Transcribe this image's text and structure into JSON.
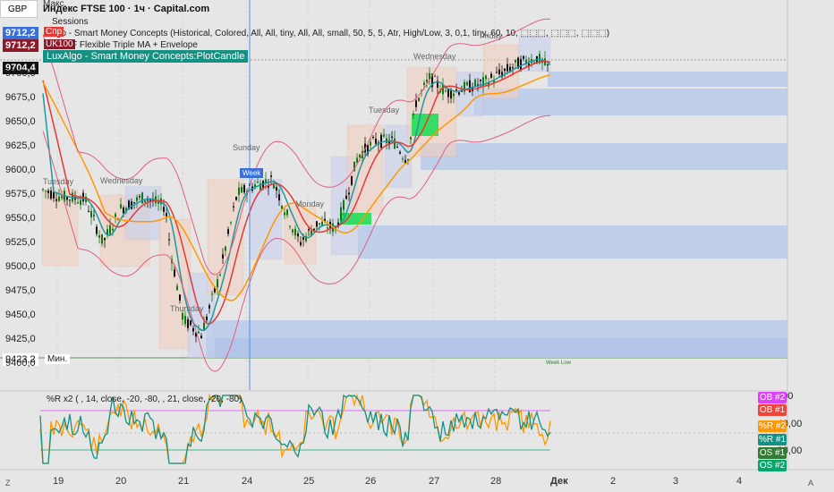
{
  "header": {
    "ticker": "GBP",
    "symbol_line": "Индекс FTSE 100 · 1ч · Capital.com",
    "top_fragment": "Макс.",
    "ind1": "Sessions",
    "ind2": "Algo - Smart Money Concepts (Historical, Colored, All, All, tiny, All, All, small, 50, 5, 5, Atr, High/Low, 3, 0,1, tiny, 60, 10, ⬚⬚⬚, ⬚⬚⬚, ⬚⬚⬚)",
    "ind3": "F Flexible Triple MA + Envelope",
    "highlight": "LuxAlgo - Smart Money Concepts:PlotCandle"
  },
  "price_boxes": [
    {
      "text": "9712,2",
      "color": "#3b6fd8"
    },
    {
      "text": "9712,2",
      "color": "#8b1a2a"
    },
    {
      "text": "9704,4",
      "color": "#111111"
    },
    {
      "text": "9423,2",
      "color": "#ffffff"
    }
  ],
  "inline_labels": {
    "box_label_2": "UK100",
    "box_label_1": "Спр",
    "min_label": "Мин."
  },
  "y_axis": [
    "9700,0",
    "9675,0",
    "9650,0",
    "9625,0",
    "9600,0",
    "9575,0",
    "9550,0",
    "9525,0",
    "9500,0",
    "9475,0",
    "9450,0",
    "9425,0",
    "9400,0"
  ],
  "x_axis": [
    "19",
    "20",
    "21",
    "24",
    "25",
    "26",
    "27",
    "28",
    "Дек",
    "2",
    "3",
    "4"
  ],
  "session_labels": [
    "Tuesday",
    "Wednesday",
    "Sunday",
    "Thursday",
    "Monday",
    "Tuesday",
    "Wednesday",
    "Friday"
  ],
  "markers": {
    "week": "Week",
    "week_low": "Week Low"
  },
  "oscillator": {
    "title": "%R x2 ( , 14, close, -20, -80, , 21, close, -20, -80)",
    "axis": [
      "0,00",
      "-40,00",
      "-80,00"
    ],
    "legend": [
      {
        "text": "OB #2",
        "color": "#e040fb"
      },
      {
        "text": "OB #1",
        "color": "#f44336"
      },
      {
        "text": "%R #2",
        "color": "#ff9800"
      },
      {
        "text": "%R #1",
        "color": "#159184"
      },
      {
        "text": "OS #1",
        "color": "#2e7d32"
      },
      {
        "text": "OS #2",
        "color": "#00a86b"
      }
    ]
  },
  "corner": {
    "left": "Z",
    "right": "A"
  },
  "colors": {
    "bg": "#e6e6e6",
    "bull": "#0f7a0f",
    "bear": "#111111",
    "teal": "#1a9aa0",
    "red": "#e53935",
    "orange": "#ff9800",
    "envelope": "#e0607e",
    "zone": "#aec3ea"
  }
}
